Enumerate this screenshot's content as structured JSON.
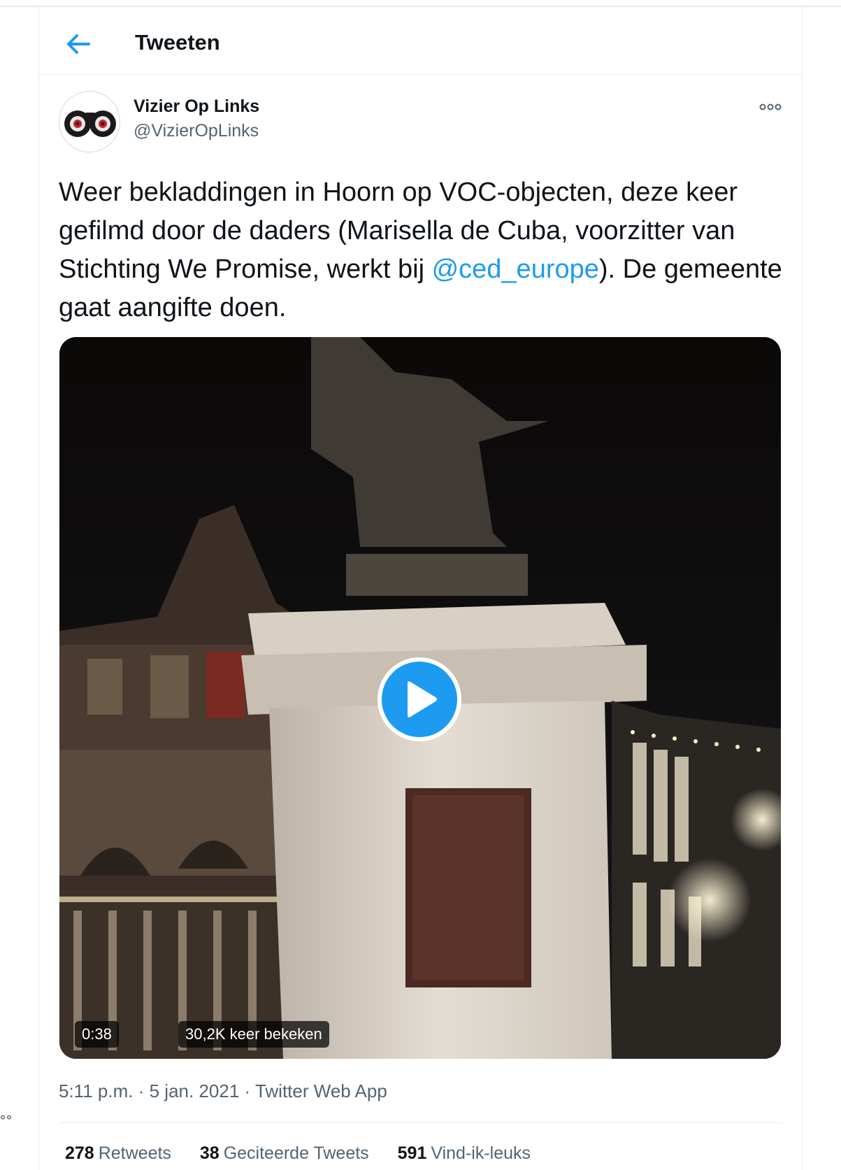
{
  "header": {
    "title": "Tweeten",
    "back_icon": "arrow-left-icon"
  },
  "author": {
    "name": "Vizier Op Links",
    "handle": "@VizierOpLinks",
    "avatar_icon": "binoculars-icon"
  },
  "tweet": {
    "text_before": "Weer bekladdingen in Hoorn op VOC-objecten, deze keer gefilmd door de daders (Marisella de Cuba, voorzitter van Stichting We Promise, werkt bij ",
    "mention": "@ced_europe",
    "text_after": "). De gemeente gaat aangifte doen."
  },
  "media": {
    "duration": "0:38",
    "views": "30,2K keer bekeken",
    "play_icon": "play-icon"
  },
  "meta": {
    "time": "5:11 p.m.",
    "separator": "·",
    "date": "5 jan. 2021",
    "source": "Twitter Web App"
  },
  "stats": [
    {
      "count": "278",
      "label": "Retweets"
    },
    {
      "count": "38",
      "label": "Geciteerde Tweets"
    },
    {
      "count": "591",
      "label": "Vind-ik-leuks"
    }
  ],
  "colors": {
    "accent": "#1d9bf0",
    "text": "#0f1419",
    "secondary": "#536471"
  }
}
